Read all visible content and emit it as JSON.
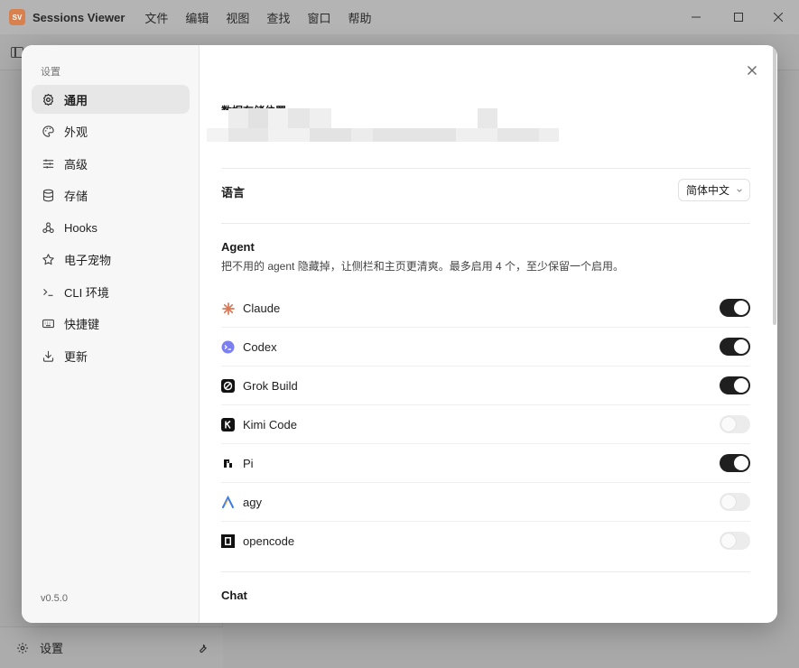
{
  "app": {
    "logo_text": "SV",
    "title": "Sessions Viewer"
  },
  "menu": [
    "文件",
    "编辑",
    "视图",
    "查找",
    "窗口",
    "帮助"
  ],
  "background": {
    "footer_label": "设置"
  },
  "settings": {
    "title": "设置",
    "version": "v0.5.0",
    "nav": [
      {
        "label": "通用",
        "icon": "gear-icon",
        "active": true
      },
      {
        "label": "外观",
        "icon": "palette-icon"
      },
      {
        "label": "高级",
        "icon": "sliders-icon"
      },
      {
        "label": "存储",
        "icon": "database-icon"
      },
      {
        "label": "Hooks",
        "icon": "webhook-icon"
      },
      {
        "label": "电子宠物",
        "icon": "star-icon"
      },
      {
        "label": "CLI 环境",
        "icon": "terminal-icon"
      },
      {
        "label": "快捷键",
        "icon": "keyboard-icon"
      },
      {
        "label": "更新",
        "icon": "download-icon"
      }
    ]
  },
  "general": {
    "storage_label": "数据存储位置",
    "language": {
      "label": "语言",
      "value": "简体中文"
    },
    "agent": {
      "title": "Agent",
      "description": "把不用的 agent 隐藏掉，让侧栏和主页更清爽。最多启用 4 个，至少保留一个启用。",
      "items": [
        {
          "name": "Claude",
          "enabled": true
        },
        {
          "name": "Codex",
          "enabled": true
        },
        {
          "name": "Grok Build",
          "enabled": true
        },
        {
          "name": "Kimi Code",
          "enabled": false
        },
        {
          "name": "Pi",
          "enabled": true
        },
        {
          "name": "agy",
          "enabled": false
        },
        {
          "name": "opencode",
          "enabled": false
        }
      ]
    },
    "chat_title": "Chat"
  }
}
